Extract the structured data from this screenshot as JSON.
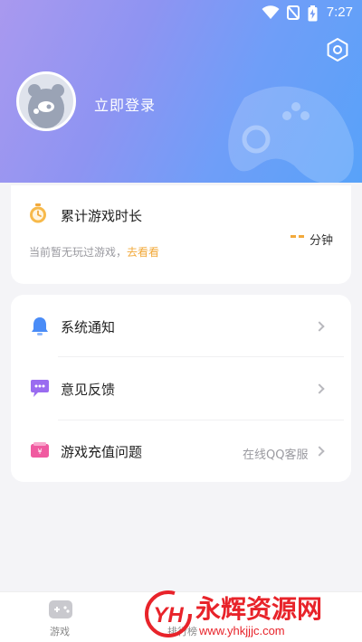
{
  "status_bar": {
    "time": "7:27"
  },
  "header": {
    "login_label": "立即登录"
  },
  "play_time_card": {
    "title": "累计游戏时长",
    "empty_text": "当前暂无玩过游戏，",
    "cta_link": "去看看",
    "unit": "分钟"
  },
  "menu": {
    "items": [
      {
        "label": "系统通知",
        "value": ""
      },
      {
        "label": "意见反馈",
        "value": ""
      },
      {
        "label": "游戏充值问题",
        "value": "在线QQ客服"
      }
    ]
  },
  "bottom_nav": {
    "tabs": [
      {
        "label": "游戏"
      },
      {
        "label": "排行榜"
      }
    ]
  },
  "watermark": {
    "logo": "YH",
    "title": "永辉资源网",
    "url": "www.yhkjjjc.com"
  },
  "colors": {
    "accent": "#f2a93b",
    "header_start": "#a999ef",
    "header_end": "#58a2f9",
    "watermark_red": "#e8232a"
  }
}
